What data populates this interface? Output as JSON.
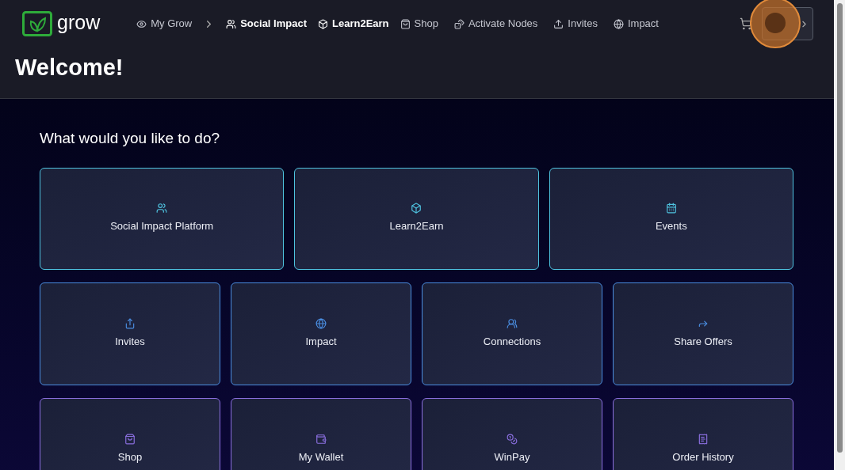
{
  "logo": {
    "text": "grow"
  },
  "nav": [
    {
      "label": "My Grow",
      "active": false
    },
    {
      "label": "Social Impact",
      "active": true
    },
    {
      "label": "Learn2Earn",
      "active": true
    },
    {
      "label": "Shop",
      "active": false
    },
    {
      "label": "Activate Nodes",
      "active": false
    },
    {
      "label": "Invites",
      "active": false
    },
    {
      "label": "Impact",
      "active": false
    }
  ],
  "page_title": "Welcome!",
  "prompt": "What would you like to do?",
  "card_rows": [
    {
      "color": "#4fc3e0",
      "cards": [
        "Social Impact Platform",
        "Learn2Earn",
        "Events"
      ]
    },
    {
      "color": "#4a8de0",
      "cards": [
        "Invites",
        "Impact",
        "Connections",
        "Share Offers"
      ]
    },
    {
      "color": "#8b6fe0",
      "cards": [
        "Shop",
        "My Wallet",
        "WinPay",
        "Order History"
      ]
    }
  ]
}
